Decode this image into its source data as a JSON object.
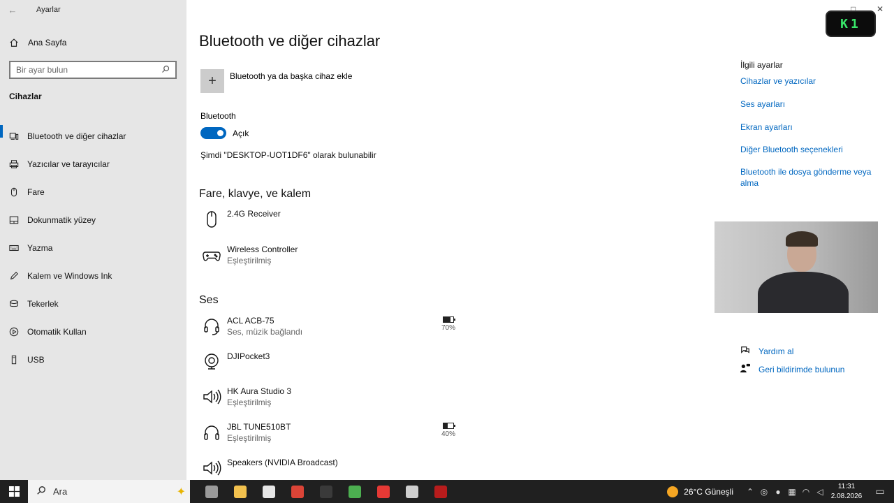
{
  "window": {
    "title": "Ayarlar",
    "back_glyph": "←",
    "restore_glyph": "□",
    "close_glyph": "✕"
  },
  "badge": {
    "text": "K1"
  },
  "sidebar": {
    "home_label": "Ana Sayfa",
    "search_placeholder": "Bir ayar bulun",
    "section_title": "Cihazlar",
    "items": [
      {
        "label": "Bluetooth ve diğer cihazlar",
        "icon": "bluetooth-devices-icon",
        "active": true
      },
      {
        "label": "Yazıcılar ve tarayıcılar",
        "icon": "printer-icon"
      },
      {
        "label": "Fare",
        "icon": "mouse-icon"
      },
      {
        "label": "Dokunmatik yüzey",
        "icon": "touchpad-icon"
      },
      {
        "label": "Yazma",
        "icon": "keyboard-icon"
      },
      {
        "label": "Kalem ve Windows Ink",
        "icon": "pen-icon"
      },
      {
        "label": "Tekerlek",
        "icon": "wheel-icon"
      },
      {
        "label": "Otomatik Kullan",
        "icon": "autoplay-icon"
      },
      {
        "label": "USB",
        "icon": "usb-icon"
      }
    ]
  },
  "main": {
    "title": "Bluetooth ve diğer cihazlar",
    "add_device_label": "Bluetooth ya da başka cihaz ekle",
    "bluetooth_label": "Bluetooth",
    "bluetooth_state": "Açık",
    "discoverable_text": "Şimdi \"DESKTOP-UOT1DF6\" olarak bulunabilir",
    "groups": [
      {
        "title": "Fare, klavye, ve kalem",
        "devices": [
          {
            "name": "2.4G Receiver",
            "status": "",
            "icon": "mouse-icon"
          },
          {
            "name": "Wireless Controller",
            "status": "Eşleştirilmiş",
            "icon": "gamepad-icon"
          }
        ]
      },
      {
        "title": "Ses",
        "devices": [
          {
            "name": "ACL ACB-75",
            "status": "Ses, müzik bağlandı",
            "icon": "headset-icon",
            "battery": "70%",
            "battery_level": 0.7
          },
          {
            "name": "DJIPocket3",
            "status": "",
            "icon": "webcam-icon"
          },
          {
            "name": "HK Aura Studio 3",
            "status": "Eşleştirilmiş",
            "icon": "speaker-icon"
          },
          {
            "name": "JBL TUNE510BT",
            "status": "Eşleştirilmiş",
            "icon": "headphones-icon",
            "battery": "40%",
            "battery_level": 0.4
          },
          {
            "name": "Speakers (NVIDIA Broadcast)",
            "status": "",
            "icon": "speaker-icon"
          }
        ]
      }
    ]
  },
  "related": {
    "title": "İlgili ayarlar",
    "links": [
      "Cihazlar ve yazıcılar",
      "Ses ayarları",
      "Ekran ayarları",
      "Diğer Bluetooth seçenekleri",
      "Bluetooth ile dosya gönderme veya alma"
    ],
    "help": [
      {
        "label": "Yardım al",
        "icon": "help-chat-icon"
      },
      {
        "label": "Geri bildirimde bulunun",
        "icon": "feedback-icon"
      }
    ]
  },
  "taskbar": {
    "search_placeholder": "Ara",
    "apps": [
      {
        "name": "task-view",
        "color": "#9a9a9a"
      },
      {
        "name": "file-explorer",
        "color": "#f2c14e"
      },
      {
        "name": "vectorworks",
        "color": "#e6e6e6"
      },
      {
        "name": "chrome",
        "color": "#db4437"
      },
      {
        "name": "terminal",
        "color": "#3a3a3a"
      },
      {
        "name": "media-player",
        "color": "#4caf50"
      },
      {
        "name": "obs",
        "color": "#e53935"
      },
      {
        "name": "settings",
        "color": "#cfcfcf"
      },
      {
        "name": "game",
        "color": "#b71c1c"
      }
    ],
    "weather": "26°C Güneşli",
    "time": "11:31",
    "date": "2.08.2026"
  }
}
